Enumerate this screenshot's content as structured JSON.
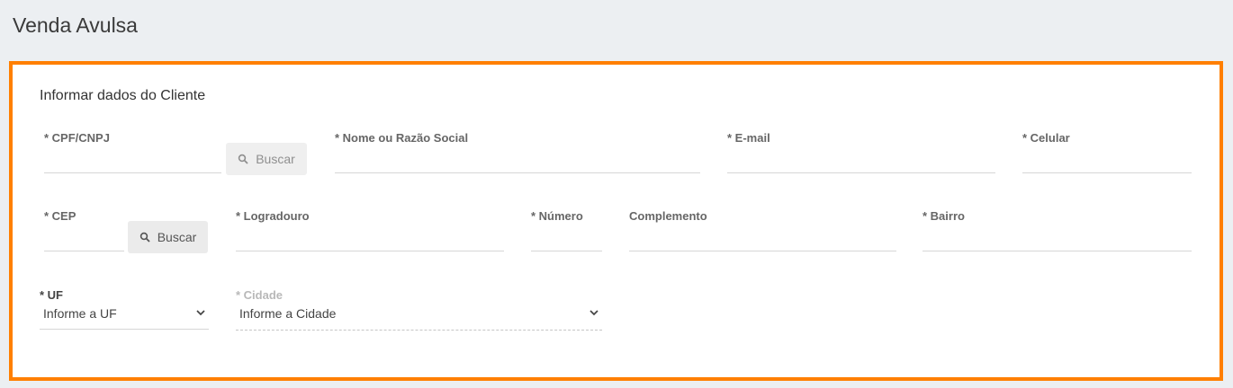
{
  "page": {
    "title": "Venda Avulsa"
  },
  "section": {
    "title": "Informar dados do Cliente"
  },
  "row1": {
    "cpf_label": "* CPF/CNPJ",
    "buscar_label": "Buscar",
    "nome_label": "* Nome ou Razão Social",
    "email_label": "* E-mail",
    "celular_label": "* Celular"
  },
  "row2": {
    "cep_label": "* CEP",
    "buscar_label": "Buscar",
    "logradouro_label": "* Logradouro",
    "numero_label": "* Número",
    "complemento_label": "Complemento",
    "bairro_label": "* Bairro"
  },
  "row3": {
    "uf_label": "* UF",
    "uf_value": "Informe a UF",
    "cidade_label": "* Cidade",
    "cidade_value": "Informe a Cidade"
  },
  "colors": {
    "accent_border": "#ff7f00",
    "background": "#eceff2"
  }
}
